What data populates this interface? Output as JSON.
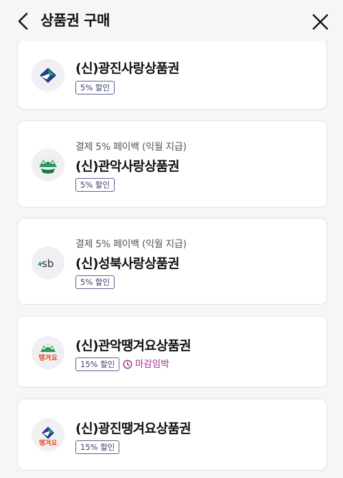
{
  "header": {
    "title": "상품권 구매"
  },
  "cards": [
    {
      "sub": "",
      "name": "(신)광진사랑상품권",
      "badge": "5% 할인",
      "deadline": "",
      "logo": "gwangjin-logo-icon"
    },
    {
      "sub": "결제 5% 페이백 (익월 지급)",
      "name": "(신)관악사랑상품권",
      "badge": "5% 할인",
      "deadline": "",
      "logo": "gwanak-logo-icon"
    },
    {
      "sub": "결제 5% 페이백 (익월 지급)",
      "name": "(신)성북사랑상품권",
      "badge": "5% 할인",
      "deadline": "",
      "logo": "seongbuk-sb-logo-icon"
    },
    {
      "sub": "",
      "name": "(신)관악땡겨요상품권",
      "badge": "15% 할인",
      "deadline": "마감임박",
      "logo": "gwanak-ddanggyeoyo-logo-icon"
    },
    {
      "sub": "",
      "name": "(신)광진땡겨요상품권",
      "badge": "15% 할인",
      "deadline": "",
      "logo": "gwangjin-ddanggyeoyo-logo-icon"
    }
  ],
  "logos": {
    "sb_text": "sb",
    "ddang_text": "땡겨요"
  },
  "colors": {
    "badge_border": "#5b5f8c",
    "deadline": "#a3228a",
    "gwangjin_blue": "#1f3f8f",
    "gwanak_green": "#2a9a5a"
  }
}
